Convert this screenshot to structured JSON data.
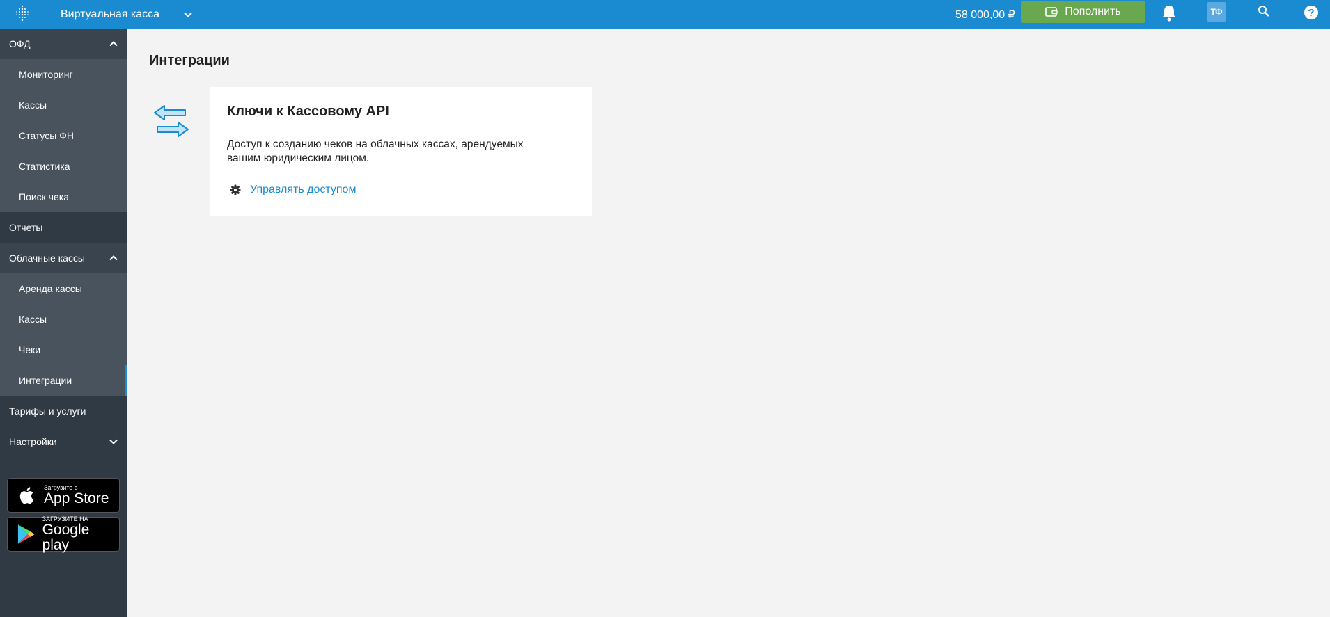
{
  "header": {
    "app_name": "Виртуальная касса",
    "balance": "58 000,00 ₽",
    "topup_label": "Пополнить",
    "avatar_initials": "ТФ",
    "help_label": "?"
  },
  "sidebar": {
    "ofd": {
      "label": "ОФД",
      "items": [
        "Мониторинг",
        "Кассы",
        "Статусы ФН",
        "Статистика",
        "Поиск чека"
      ]
    },
    "reports_label": "Отчеты",
    "cloud": {
      "label": "Облачные кассы",
      "items": [
        "Аренда кассы",
        "Кассы",
        "Чеки",
        "Интеграции"
      ]
    },
    "tariffs_label": "Тарифы и услуги",
    "settings_label": "Настройки",
    "appstore": {
      "small": "Загрузите в",
      "big": "App Store"
    },
    "googleplay": {
      "small": "ЗАГРУЗИТЕ НА",
      "big": "Google play"
    }
  },
  "main": {
    "title": "Интеграции",
    "card": {
      "title": "Ключи к Кассовому API",
      "description": "Доступ к созданию чеков на облачных кассах, арендуемых вашим юридическим лицом.",
      "manage_label": "Управлять доступом"
    }
  },
  "colors": {
    "header_bg": "#1a8bd0",
    "sidebar_bg": "#2f3a44",
    "topup_green": "#6aa84f",
    "link_blue": "#1a8bd0"
  }
}
